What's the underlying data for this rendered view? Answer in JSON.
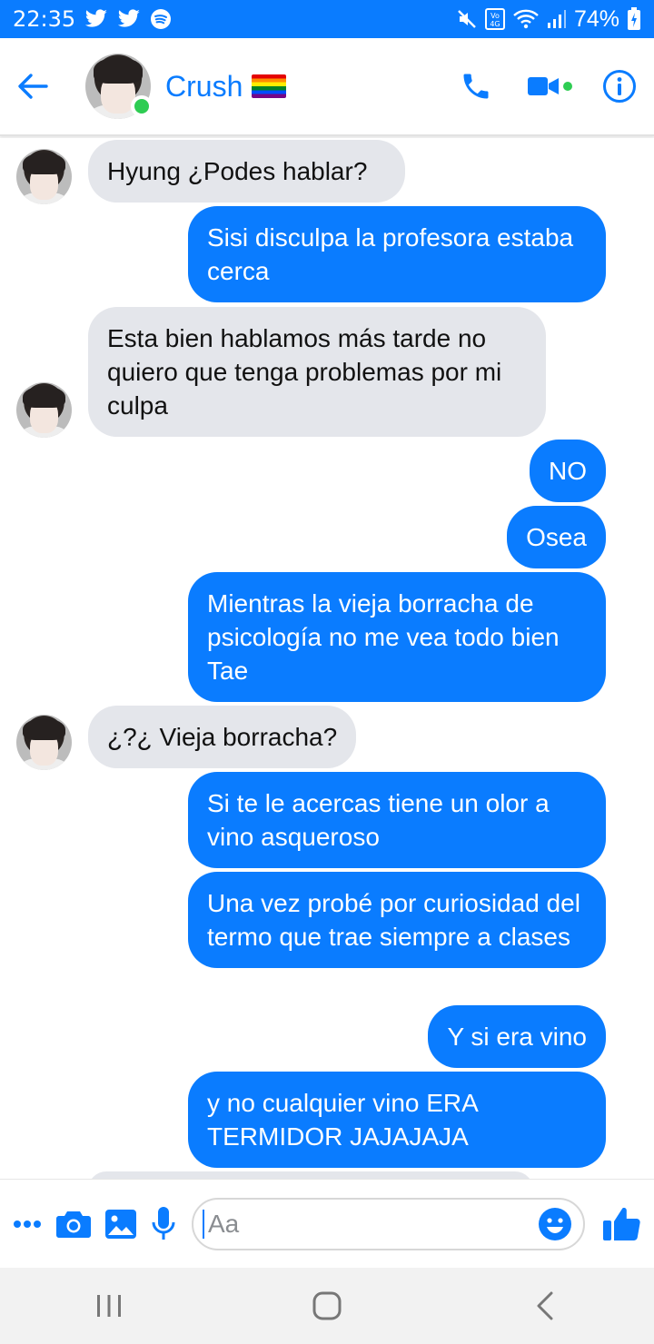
{
  "status_bar": {
    "time": "22:35",
    "battery": "74%"
  },
  "header": {
    "contact_name": "Crush",
    "contact_flag_icon": "rainbow-flag-icon",
    "online": true
  },
  "messages": [
    {
      "side": "in",
      "text": "Hyung ¿Podes hablar?"
    },
    {
      "side": "out",
      "text": "Sisi disculpa la profesora estaba cerca"
    },
    {
      "side": "in",
      "text": "Esta bien hablamos más tarde no quiero que tenga problemas por mi culpa"
    },
    {
      "side": "out",
      "text": "NO"
    },
    {
      "side": "out",
      "text": "Osea"
    },
    {
      "side": "out",
      "text": "Mientras la vieja borracha de psicología no me vea todo bien Tae"
    },
    {
      "side": "in",
      "text": "¿?¿ Vieja borracha?"
    },
    {
      "side": "out",
      "text": "Si te le acercas tiene un olor a vino asqueroso"
    },
    {
      "side": "out",
      "text": "Una vez probé por curiosidad del termo que trae siempre a clases"
    },
    {
      "side": "out",
      "text": "Y si era vino"
    },
    {
      "side": "out",
      "text": "y no cualquier vino ERA TERMIDOR JAJAJAJA"
    }
  ],
  "composer": {
    "placeholder": "Aa"
  },
  "colors": {
    "accent": "#0a7cff",
    "incoming_bubble": "#e4e6eb",
    "online": "#2ecc52"
  }
}
